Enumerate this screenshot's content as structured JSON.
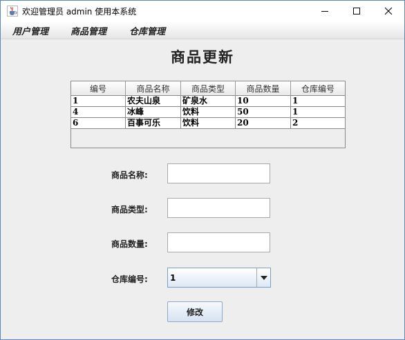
{
  "window": {
    "title": "欢迎管理员 admin 使用本系统",
    "icon": "java-cup-icon"
  },
  "menubar": {
    "items": [
      "用户管理",
      "商品管理",
      "仓库管理"
    ]
  },
  "page": {
    "title": "商品更新"
  },
  "table": {
    "columns": [
      "编号",
      "商品名称",
      "商品类型",
      "商品数量",
      "仓库编号"
    ],
    "rows": [
      [
        "1",
        "农夫山泉",
        "矿泉水",
        "10",
        "1"
      ],
      [
        "4",
        "冰峰",
        "饮料",
        "50",
        "1"
      ],
      [
        "6",
        "百事可乐",
        "饮料",
        "20",
        "2"
      ]
    ]
  },
  "form": {
    "name_label": "商品名称:",
    "name_value": "",
    "type_label": "商品类型:",
    "type_value": "",
    "qty_label": "商品数量:",
    "qty_value": "",
    "warehouse_label": "仓库编号:",
    "warehouse_selected": "1",
    "submit_label": "修改"
  }
}
